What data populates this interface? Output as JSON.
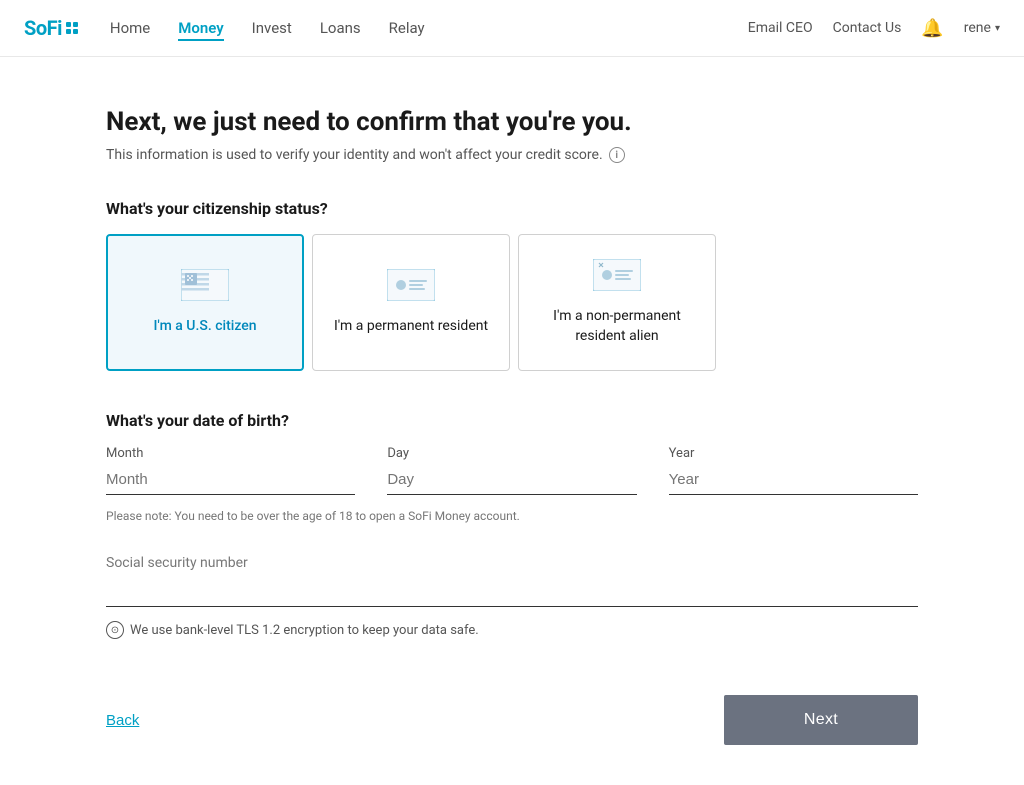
{
  "navbar": {
    "logo": "SoFi",
    "nav_items": [
      {
        "label": "Home",
        "active": false
      },
      {
        "label": "Money",
        "active": true
      },
      {
        "label": "Invest",
        "active": false
      },
      {
        "label": "Loans",
        "active": false
      },
      {
        "label": "Relay",
        "active": false
      }
    ],
    "email_ceo": "Email CEO",
    "contact_us": "Contact Us",
    "user": "rene"
  },
  "page": {
    "title": "Next, we just need to confirm that you're you.",
    "subtitle": "This information is used to verify your identity and won't affect your credit score.",
    "citizenship_question": "What's your citizenship status?",
    "citizenship_options": [
      {
        "id": "us_citizen",
        "label": "I'm a U.S. citizen",
        "selected": true
      },
      {
        "id": "permanent_resident",
        "label": "I'm a permanent resident",
        "selected": false
      },
      {
        "id": "non_permanent",
        "label": "I'm a non-permanent resident alien",
        "selected": false
      }
    ],
    "dob_question": "What's your date of birth?",
    "dob_fields": [
      {
        "label": "Month",
        "placeholder": "Month"
      },
      {
        "label": "Day",
        "placeholder": "Day"
      },
      {
        "label": "Year",
        "placeholder": "Year"
      }
    ],
    "dob_note": "Please note: You need to be over the age of 18 to open a SoFi Money account.",
    "ssn_label": "Social security number",
    "ssn_placeholder": "",
    "encryption_note": "We use bank-level TLS 1.2 encryption to keep your data safe.",
    "back_label": "Back",
    "next_label": "Next"
  }
}
